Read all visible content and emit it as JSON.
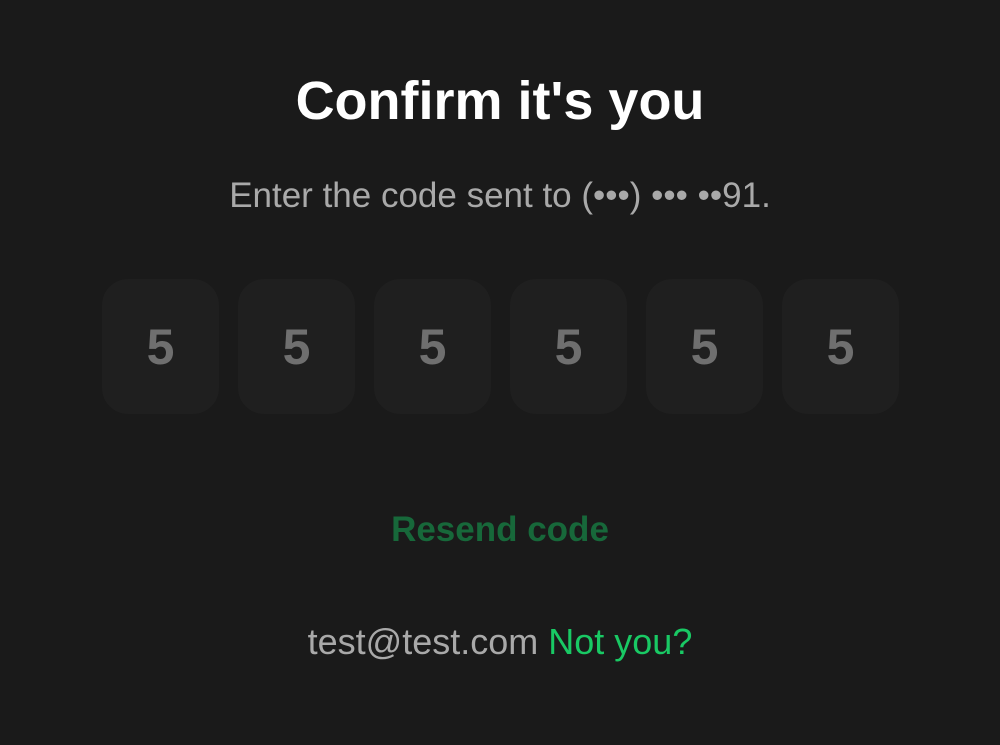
{
  "title": "Confirm it's you",
  "subtitle": "Enter the code sent to (•••) ••• ••91.",
  "code_digits": [
    "5",
    "5",
    "5",
    "5",
    "5",
    "5"
  ],
  "resend_label": "Resend code",
  "account": {
    "email": "test@test.com",
    "not_you_label": "Not you?"
  },
  "colors": {
    "background": "#1a1a1a",
    "code_box": "#1f1f1f",
    "resend_green": "#17683a",
    "link_green": "#19c964"
  }
}
